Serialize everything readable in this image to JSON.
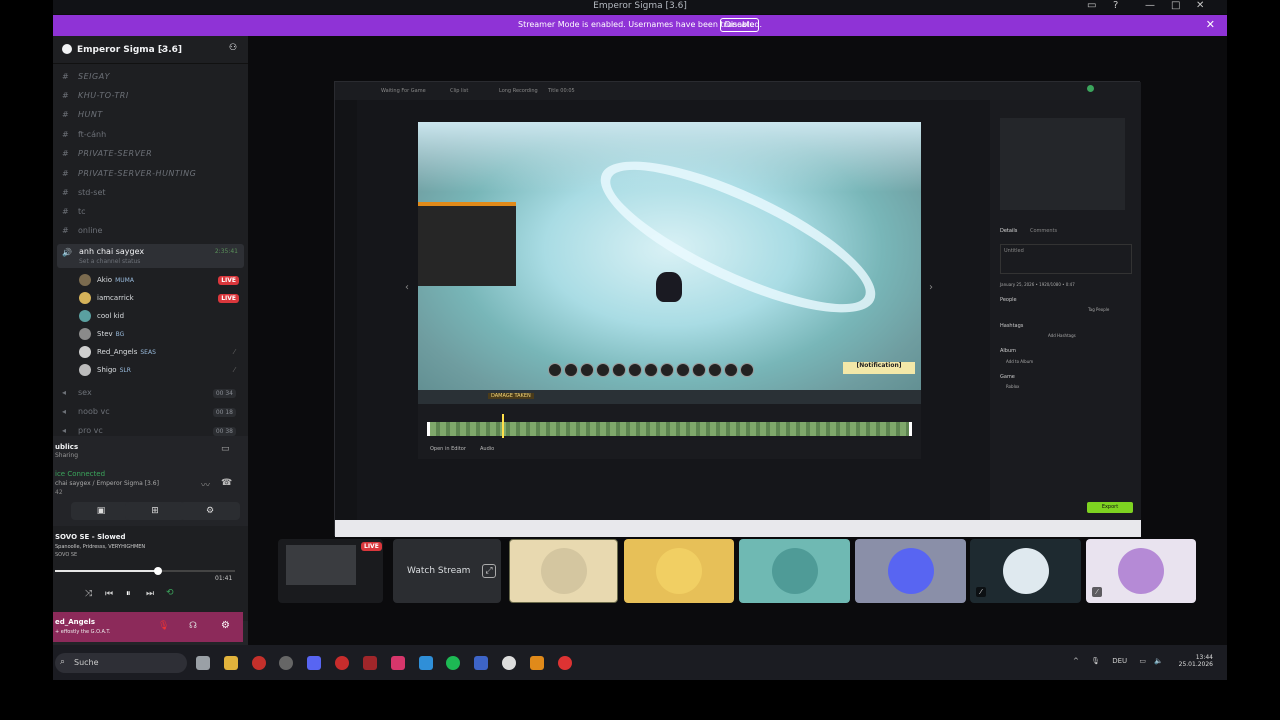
{
  "window": {
    "title": "Emperor Sigma [3.6]"
  },
  "banner": {
    "message": "Streamer Mode is enabled. Usernames have been truncated.",
    "disable_label": "Disable"
  },
  "server": {
    "name": "Emperor Sigma [3.6]"
  },
  "channels": [
    {
      "label": "SEIGAY",
      "style": "italic"
    },
    {
      "label": "KHU-TO-TRI",
      "style": "italic"
    },
    {
      "label": "HUNT",
      "style": "italic"
    },
    {
      "label": "ft-cánh",
      "style": "normal"
    },
    {
      "label": "PRIVATE-SERVER",
      "style": "italic"
    },
    {
      "label": "PRIVATE-SERVER-HUNTING",
      "style": "italic"
    },
    {
      "label": "std-set",
      "style": "normal"
    },
    {
      "label": "tc",
      "style": "normal"
    },
    {
      "label": "online",
      "style": "normal"
    }
  ],
  "voice_channel": {
    "name": "anh chai saygex",
    "status": "Set a channel status",
    "time": "2:35:41",
    "members": [
      {
        "name": "Akio",
        "tag": "MUMA",
        "live": true,
        "color": "#7b6b4f"
      },
      {
        "name": "iamcarrick",
        "tag": "",
        "live": true,
        "color": "#d6b35a"
      },
      {
        "name": "cool kid",
        "tag": "",
        "live": false,
        "color": "#5aa0a0"
      },
      {
        "name": "Stev",
        "tag": "BG",
        "live": false,
        "color": "#8a8a8a"
      },
      {
        "name": "Red_Angels",
        "tag": "SEAS",
        "live": false,
        "color": "#cfcfcf"
      },
      {
        "name": "Shigo",
        "tag": "SLR",
        "live": false,
        "color": "#bbbbbb"
      }
    ],
    "live_label": "LIVE"
  },
  "other_voice_channels": [
    {
      "label": "sex",
      "count": "00 34"
    },
    {
      "label": "noob vc",
      "count": "00 18"
    },
    {
      "label": "pro vc",
      "count": "00 38"
    }
  ],
  "voice_panel": {
    "title": "ublics",
    "subtitle": "Sharing",
    "connected": "ice Connected",
    "location": "chai saygex / Emperor Sigma [3.6]",
    "ping": "42"
  },
  "player": {
    "track": "SOVO SE - Slowed",
    "artists": "Spanoolle, Pridresss, VERYHIGHMEN",
    "album": "SOVO SE",
    "time": "01:41",
    "progress": 0.57
  },
  "user": {
    "name": "ed_Angels",
    "status": "+ effostly the G.O.A.T."
  },
  "inner_app": {
    "tabs": [
      "Waiting For Game",
      "Clip list",
      "Long Recording",
      "Title 00:05"
    ],
    "open_editor": "Open in Editor",
    "audio": "Audio",
    "details_tab": "Details",
    "comments_tab": "Comments",
    "untitled": "Untitled",
    "date": "January 25, 2026 • 1920/1080 • 0:47",
    "people": "People",
    "tag_people": "Tag People",
    "hashtags": "Hashtags",
    "add_hashtag": "Add Hashtags",
    "album": "Album",
    "add_to_album": "Add to Album",
    "game": "Game",
    "game_name": "Roblox",
    "export": "Export",
    "notification": "[Notification]",
    "damage": "DAMAGE TAKEN"
  },
  "tiles": {
    "live_label": "LIVE",
    "watch_stream": "Watch Stream",
    "avatar_colors": [
      "#e8d9b0",
      "#e7c058",
      "#6fb9b3",
      "#8a8fa8",
      "#1e2a30",
      "#e9e3ef"
    ]
  },
  "taskbar": {
    "search_placeholder": "Suche",
    "lang": "DEU",
    "time": "13:44",
    "date": "25.01.2026"
  }
}
